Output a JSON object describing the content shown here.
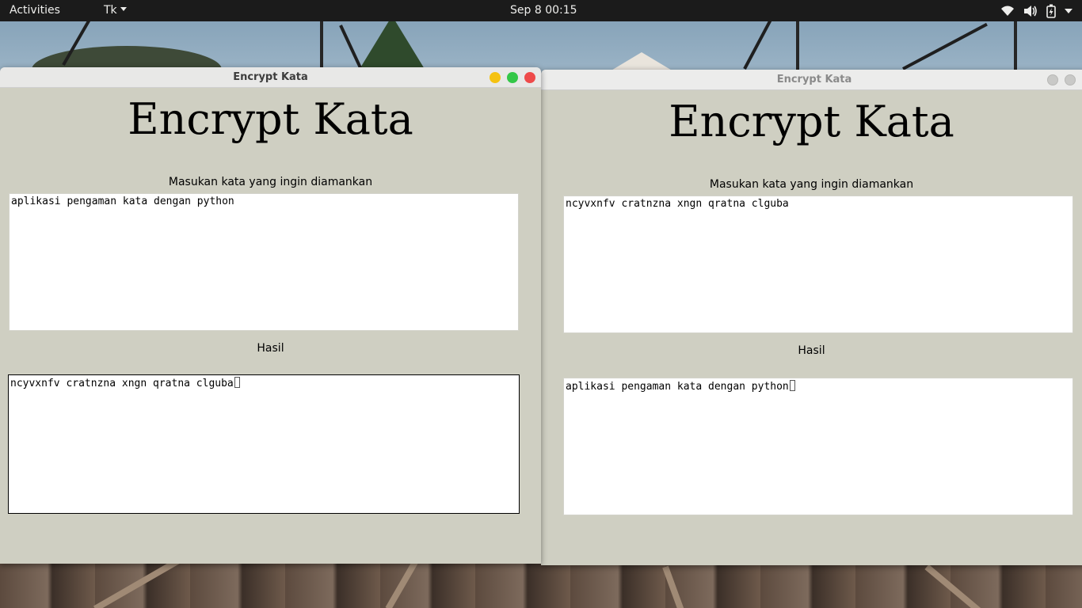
{
  "topbar": {
    "activities": "Activities",
    "app_menu": "Tk",
    "clock": "Sep 8  00:15",
    "tray_icons": [
      "wifi-icon",
      "volume-icon",
      "battery-icon",
      "system-menu-caret"
    ]
  },
  "window_left": {
    "title": "Encrypt Kata",
    "heading": "Encrypt Kata",
    "input_label": "Masukan kata yang ingin diamankan",
    "input_value": "aplikasi pengaman kata dengan python",
    "result_label": "Hasil",
    "result_value": "ncyvxnfv cratnzna xngn qratna clguba",
    "controls": [
      "minimize",
      "maximize",
      "close"
    ],
    "active": true
  },
  "window_right": {
    "title": "Encrypt Kata",
    "heading": "Encrypt Kata",
    "input_label": "Masukan kata yang ingin diamankan",
    "input_value": "ncyvxnfv cratnzna xngn qratna clguba",
    "result_label": "Hasil",
    "result_value": "aplikasi pengaman kata dengan python",
    "controls": [
      "minimize",
      "maximize",
      "close"
    ],
    "active": false
  },
  "colors": {
    "topbar_bg": "#1b1b1b",
    "window_bg": "#cfcfc2",
    "minimize": "#f5c211",
    "maximize": "#33c748",
    "close": "#ee4a4a"
  }
}
